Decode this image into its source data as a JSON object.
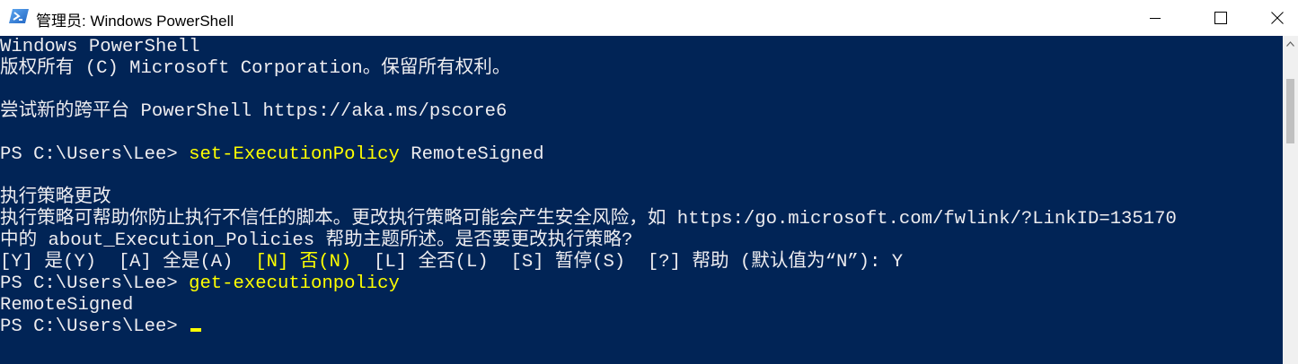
{
  "window": {
    "title": "管理员: Windows PowerShell",
    "icon": "powershell-icon",
    "controls": [
      "minimize-icon",
      "maximize-icon",
      "close-icon"
    ]
  },
  "console": {
    "colors": {
      "background": "#012456",
      "foreground": "#eeedf0",
      "highlight": "#ffff00"
    },
    "lines": [
      {
        "text": "Windows PowerShell"
      },
      {
        "text": "版权所有 (C) Microsoft Corporation。保留所有权利。"
      },
      {
        "text": ""
      },
      {
        "text": "尝试新的跨平台 PowerShell https://aka.ms/pscore6"
      },
      {
        "text": ""
      },
      {
        "prompt": "PS C:\\Users\\Lee> ",
        "command": "set-ExecutionPolicy",
        "arg": " RemoteSigned"
      },
      {
        "text": ""
      },
      {
        "text": "执行策略更改"
      },
      {
        "text": "执行策略可帮助你防止执行不信任的脚本。更改执行策略可能会产生安全风险，如 https:/go.microsoft.com/fwlink/?LinkID=135170"
      },
      {
        "text": "中的 about_Execution_Policies 帮助主题所述。是否要更改执行策略?"
      },
      {
        "opt_pre": "[Y] 是(Y)  [A] 全是(A)  ",
        "opt_hl": "[N] 否(N)",
        "opt_post": "  [L] 全否(L)  [S] 暂停(S)  [?] 帮助 (默认值为“N”): Y"
      },
      {
        "prompt": "PS C:\\Users\\Lee> ",
        "command": "get-executionpolicy",
        "arg": ""
      },
      {
        "text": "RemoteSigned"
      },
      {
        "prompt": "PS C:\\Users\\Lee> ",
        "command": "",
        "arg": "",
        "cursor": true
      }
    ]
  },
  "scrollbar": {
    "up_icon": "scroll-up-arrow-icon"
  }
}
